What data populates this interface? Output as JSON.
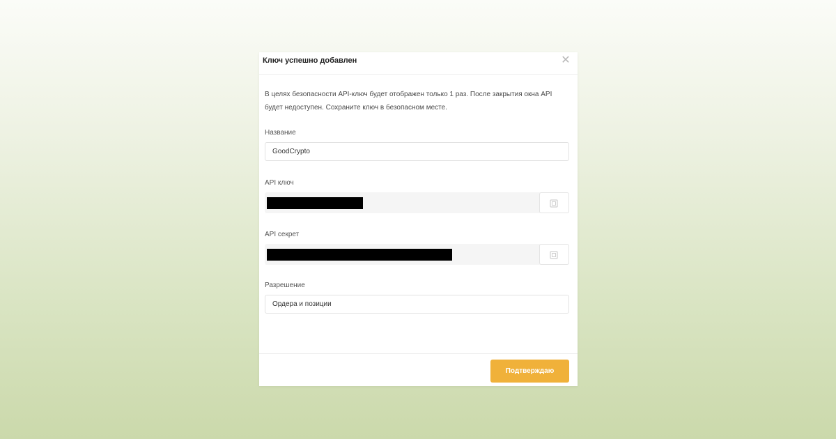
{
  "modal": {
    "title": "Ключ успешно добавлен",
    "close_icon": "close-icon",
    "notice": "В целях безопасности API-ключ будет отображен только 1 раз. После закрытия окна API будет недоступен. Сохраните ключ в безопасном месте.",
    "fields": {
      "name": {
        "label": "Название",
        "value": "GoodCrypto"
      },
      "api_key": {
        "label": "API ключ",
        "value_redacted": true,
        "copy_icon": "copy-icon"
      },
      "api_secret": {
        "label": "API секрет",
        "value_redacted": true,
        "copy_icon": "copy-icon"
      },
      "permission": {
        "label": "Разрешение",
        "value": "Ордера и позиции"
      }
    },
    "confirm_label": "Подтверждаю"
  },
  "colors": {
    "accent": "#f0b13a",
    "background_top": "#fbfcf8",
    "background_bottom": "#cbd9ab",
    "redaction": "#000000"
  }
}
